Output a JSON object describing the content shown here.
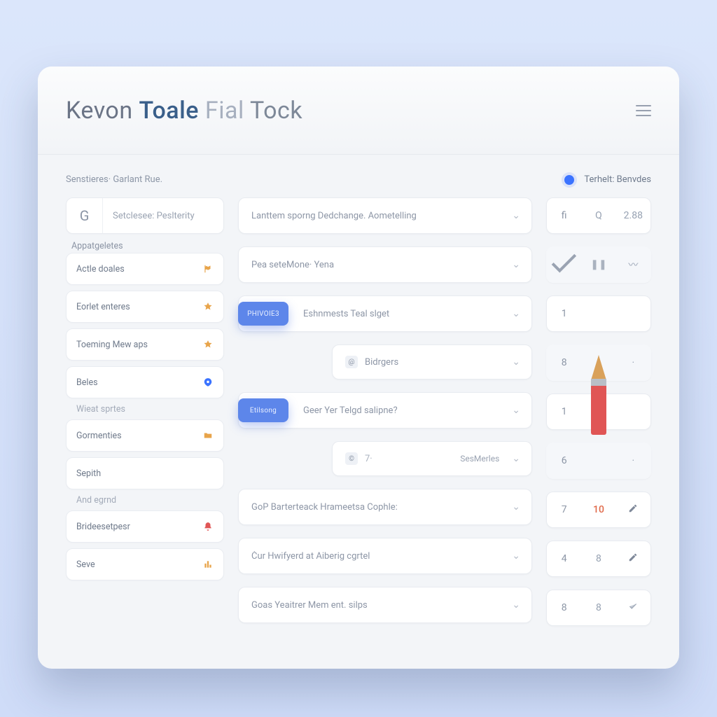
{
  "title": {
    "w1": "Kevon",
    "w2": "Toale",
    "w3": "Fial",
    "w4": "Tock"
  },
  "subtitle": "Senstieres· Garlant Rue.",
  "legend": "Terhelt: Benvdes",
  "search": {
    "g": "G",
    "label": "Setclesee: Peslterity"
  },
  "sidebar": {
    "heading": "Appatgeletes",
    "items": [
      {
        "label": "Actle doales",
        "icon": "flag"
      },
      {
        "label": "Eorlet enteres",
        "icon": "star"
      },
      {
        "label": "Toeming Mew aps",
        "icon": "star"
      },
      {
        "label": "Beles",
        "icon": "tag"
      }
    ],
    "ghost1": "Wieat sprtes",
    "items2": [
      {
        "label": "Gormenties",
        "icon": "folder"
      },
      {
        "label": "Sepith",
        "icon": ""
      }
    ],
    "ghost2": "And egrnd",
    "items3": [
      {
        "label": "Brideesetpesr",
        "icon": "bell"
      },
      {
        "label": "Seve",
        "icon": "chart"
      }
    ]
  },
  "rows": [
    {
      "type": "plain",
      "text": "Lanttem sporng Dedchange. Aometelling"
    },
    {
      "type": "plain",
      "text": "Pea seteMone· Yena"
    },
    {
      "type": "pill",
      "pill": "PHIVOIE3",
      "text": "Eshnmests  Teal slget"
    },
    {
      "type": "inset",
      "icon": "@",
      "text": "Bidrgers"
    },
    {
      "type": "pill",
      "pill": "Etilsong",
      "text": "Geer Yer Telgd salipne?"
    },
    {
      "type": "inset",
      "icon": "©",
      "side": "SesMerles",
      "smalltext": "7·"
    },
    {
      "type": "plain",
      "text": "GoP Barterteack Hrameetsa Cophle:"
    },
    {
      "type": "plain",
      "text": "Čur Hwifyerd at Aiberig cgrtel"
    },
    {
      "type": "plain",
      "text": "Goas  Yeaitrer  Mem ent. silps"
    }
  ],
  "metrics": [
    {
      "a": "fi",
      "b": "Q",
      "c": "2.88",
      "soft": false,
      "edit": ""
    },
    {
      "a": "✓",
      "b": "⏸",
      "c": "~",
      "soft": true,
      "icons": true
    },
    {
      "a": "1",
      "b": "",
      "c": "",
      "soft": false
    },
    {
      "a": "8",
      "b": "",
      "c": "·",
      "soft": true
    },
    {
      "a": "1",
      "b": "",
      "c": "",
      "soft": false
    },
    {
      "a": "6",
      "b": "",
      "c": "·",
      "soft": true
    },
    {
      "a": "7",
      "b": "10",
      "c": "edit",
      "soft": false,
      "red": true
    },
    {
      "a": "4",
      "b": "8",
      "c": "edit",
      "soft": false
    },
    {
      "a": "8",
      "b": "8",
      "c": "check",
      "soft": false
    }
  ]
}
